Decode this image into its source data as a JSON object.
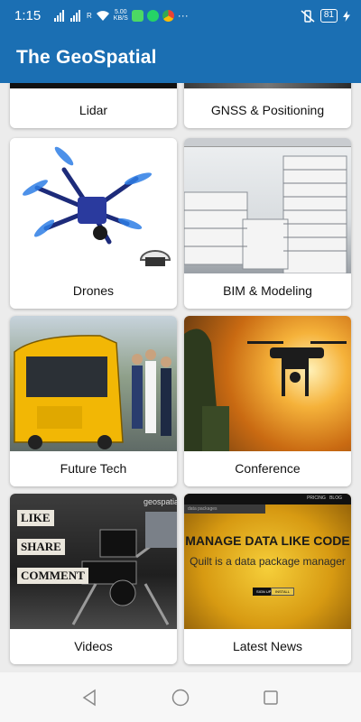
{
  "status_bar": {
    "time": "1:15",
    "net_speed_value": "5.00",
    "net_speed_unit": "KB/S",
    "carrier_tag": "R",
    "more": "···",
    "battery": "81"
  },
  "app_bar": {
    "title": "The GeoSpatial"
  },
  "tiles": [
    {
      "label": "Lidar"
    },
    {
      "label": "GNSS & Positioning"
    },
    {
      "label": "Drones"
    },
    {
      "label": "BIM & Modeling"
    },
    {
      "label": "Future Tech"
    },
    {
      "label": "Conference"
    },
    {
      "label": "Videos"
    },
    {
      "label": "Latest News"
    }
  ],
  "videos_overlay": {
    "line1": "LIKE",
    "line2": "SHARE",
    "line3": "COMMENT",
    "brand": "geospatial"
  },
  "news_overlay": {
    "headline": "MANAGE DATA LIKE CODE",
    "sub": "Quilt is a data package manager",
    "top_link1": "PRICING",
    "top_link2": "BLOG",
    "search_hint": "data packages",
    "btn1": "SIGN UP",
    "btn2": "INSTALL"
  },
  "colors": {
    "primary": "#1b6fb3",
    "background": "#ececec",
    "card": "#ffffff"
  }
}
